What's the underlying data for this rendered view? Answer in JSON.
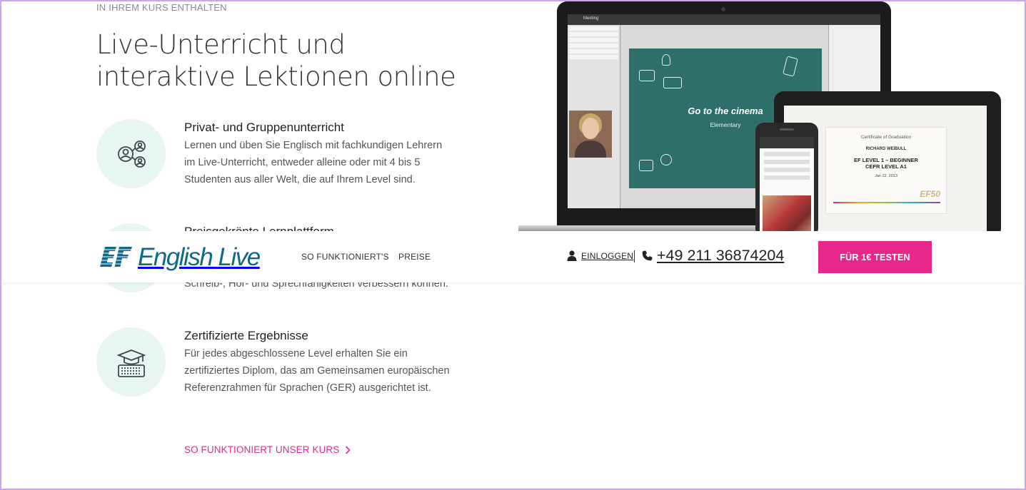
{
  "section": {
    "eyebrow": "IN IHREM KURS ENTHALTEN",
    "headline_line1": "Live-Unterricht und",
    "headline_line2": "interaktive Lektionen online"
  },
  "features": [
    {
      "title": "Privat- und Gruppenunterricht",
      "text": "Lernen und üben Sie Englisch mit fachkundigen Lehrern im Live-Unterricht, entweder alleine oder mit 4 bis 5 Studenten aus aller Welt, die auf Ihrem Level sind.",
      "icon": "people-group-icon"
    },
    {
      "title": "Preisgekrönte Lernplattform",
      "text": "Schreib-, Hör- und Sprechfähigkeiten verbessern können.",
      "icon": "platform-icon"
    },
    {
      "title": "Zertifizierte Ergebnisse",
      "text": "Für jedes abgeschlossene Level erhalten Sie ein zertifiziertes Diplom, das am Gemeinsamen europäischen Referenzrahmen für Sprachen (GER) ausgerichtet ist.",
      "icon": "graduation-cap-icon"
    }
  ],
  "course_link": "SO FUNKTIONIERT UNSER KURS",
  "hero": {
    "app_title": "Meeting",
    "board_title": "Go to the cinema",
    "board_subtitle": "Elementary",
    "certificate": {
      "heading": "Certificate of Graduation",
      "name": "RICHARD WEIBULL",
      "level_line1": "EF LEVEL 1 – BEGINNER",
      "level_line2": "CEFR LEVEL A1",
      "date": "Jan 22, 2013"
    }
  },
  "navbar": {
    "brand": "English Live",
    "links": [
      "SO FUNKTIONIERT'S",
      "PREISE"
    ],
    "login": "EINLOGGEN",
    "phone": "+49 211 36874204",
    "cta": "FÜR 1€ TESTEN"
  },
  "colors": {
    "accent": "#e8278a",
    "brand_blue": "#0e6a8b",
    "mint": "#e7f6f2"
  }
}
